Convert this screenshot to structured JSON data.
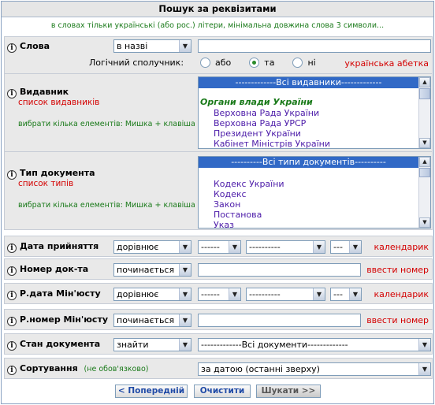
{
  "title": "Пошук за реквізитами",
  "subtitle": "в словах тільки українські (або рос.) літери, мінімальна довжина слова 3 символи...",
  "info_icon": "i",
  "words": {
    "label": "Слова",
    "mode": "в назві",
    "query": "",
    "logic_label": "Логічний сполучник:",
    "options": [
      "або",
      "та",
      "ні"
    ],
    "selected": "та",
    "alphabet_link": "українська абетка"
  },
  "publisher": {
    "label": "Видавник",
    "sublink": "список видавників",
    "hint": "вибрати кілька елементів: Мишка + клавіша Ctrl",
    "selected": "-------------Всі видавники-------------",
    "group": "Органи влади України",
    "items": [
      "Верховна Рада України",
      "Верховна Рада УРСР",
      "Президент України",
      "Кабінет Міністрів України"
    ]
  },
  "doctype": {
    "label": "Тип документа",
    "sublink": "список типів",
    "hint": "вибрати кілька елементів: Мишка + клавіша Ctrl",
    "selected": "----------Всі типи документів----------",
    "items": [
      "Кодекс України",
      "Кодекс",
      "Закон",
      "Постанова",
      "Указ"
    ]
  },
  "adopt_date": {
    "label": "Дата прийняття",
    "op": "дорівнює",
    "day": "------",
    "month": "----------",
    "year": "---",
    "link": "календарик"
  },
  "doc_number": {
    "label": "Номер док-та",
    "op": "починається",
    "value": "",
    "link": "ввести номер"
  },
  "reg_date": {
    "label": "Р.дата Мін'юсту",
    "op": "дорівнює",
    "day": "------",
    "month": "----------",
    "year": "---",
    "link": "календарик"
  },
  "reg_number": {
    "label": "Р.номер Мін'юсту",
    "op": "починається",
    "value": "",
    "link": "ввести номер"
  },
  "status": {
    "label": "Стан документа",
    "op": "знайти",
    "value": "-------------Всі документи-------------"
  },
  "sort": {
    "label": "Сортування",
    "note": "(не обов'язково)",
    "value": "за датою (останні зверху)"
  },
  "buttons": {
    "prev": "< Попередній",
    "clear": "Очистити",
    "search": "Шукати >>"
  },
  "icons": {
    "dropdown": "▼",
    "scroll_up": "▲",
    "scroll_down": "▼"
  },
  "colors": {
    "selection": "#3169c6",
    "link_red": "#d40000",
    "hint_green": "#1a7a1a",
    "option_purple": "#4b1aa8"
  }
}
